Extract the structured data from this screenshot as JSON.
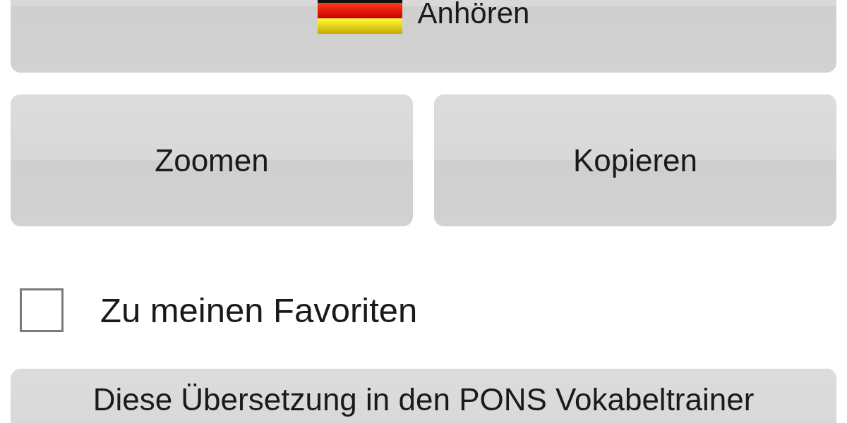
{
  "listen_button": {
    "label": "Anhören"
  },
  "buttons": [
    {
      "label": "Zoomen"
    },
    {
      "label": "Kopieren"
    }
  ],
  "favorite": {
    "label": "Zu meinen Favoriten",
    "checked": false
  },
  "trainer_button": {
    "label": "Diese Übersetzung in den PONS Vokabeltrainer"
  }
}
